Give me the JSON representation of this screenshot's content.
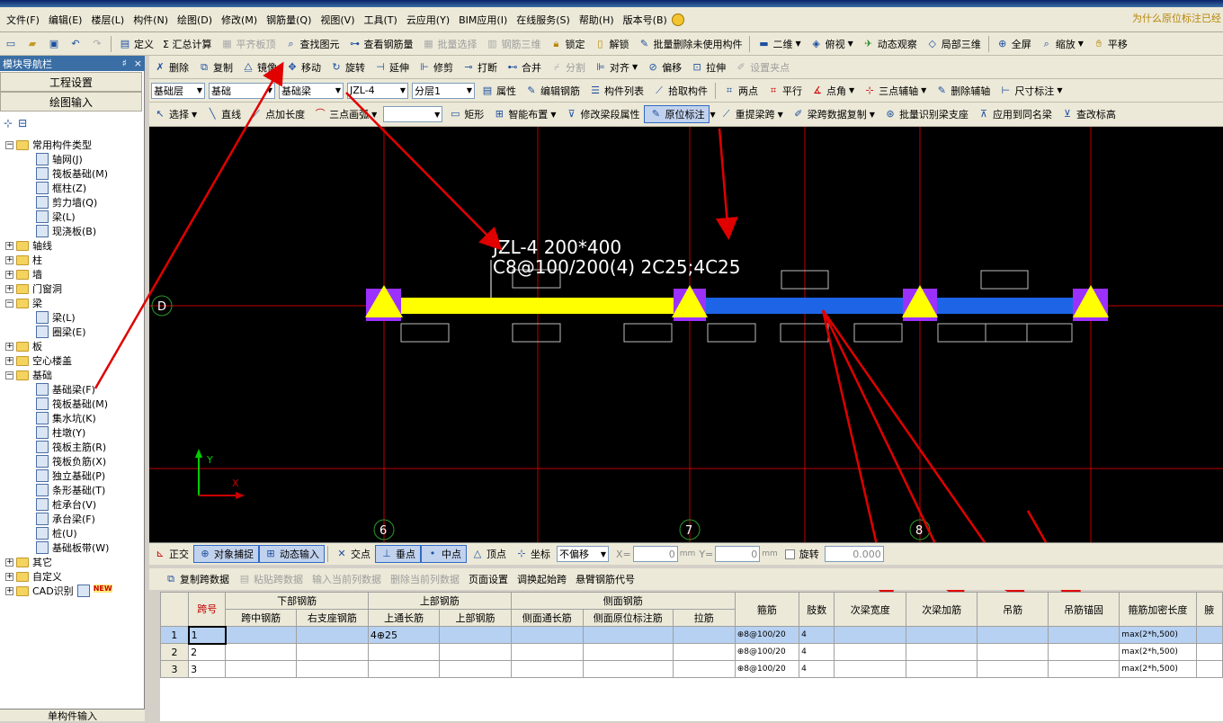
{
  "menu": [
    "文件(F)",
    "编辑(E)",
    "楼层(L)",
    "构件(N)",
    "绘图(D)",
    "修改(M)",
    "钢筋量(Q)",
    "视图(V)",
    "工具(T)",
    "云应用(Y)",
    "BIM应用(I)",
    "在线服务(S)",
    "帮助(H)",
    "版本号(B)"
  ],
  "hint_text": "为什么原位标注已经",
  "toolbar1": [
    "定义",
    "Σ 汇总计算",
    "平齐板顶",
    "查找图元",
    "查看钢筋量",
    "批量选择",
    "钢筋三维",
    "锁定",
    "解锁",
    "批量删除未使用构件",
    "二维",
    "俯视",
    "动态观察",
    "局部三维",
    "全屏",
    "缩放",
    "平移"
  ],
  "toolbar2": [
    "删除",
    "复制",
    "镜像",
    "移动",
    "旋转",
    "延伸",
    "修剪",
    "打断",
    "合并",
    "分割",
    "对齐",
    "偏移",
    "拉伸",
    "设置夹点"
  ],
  "toolbar3": {
    "floor": "基础层",
    "cat": "基础",
    "type": "基础梁",
    "comp": "JZL-4",
    "layer": "分层1",
    "btns": [
      "属性",
      "编辑钢筋",
      "构件列表",
      "拾取构件",
      "两点",
      "平行",
      "点角",
      "三点辅轴",
      "删除辅轴",
      "尺寸标注"
    ]
  },
  "toolbar4": [
    "选择",
    "直线",
    "点加长度",
    "三点画弧",
    "矩形",
    "智能布置",
    "修改梁段属性",
    "原位标注",
    "重提梁跨",
    "梁跨数据复制",
    "批量识别梁支座",
    "应用到同名梁",
    "查改标高"
  ],
  "left": {
    "title": "模块导航栏",
    "pin": "♯",
    "close": "×",
    "btn1": "工程设置",
    "btn2": "绘图输入",
    "bottom": "单构件输入",
    "tree": [
      {
        "label": "常用构件类型",
        "kind": "folder",
        "exp": "−",
        "indent": 0
      },
      {
        "label": "轴网(J)",
        "kind": "leaf",
        "indent": 1
      },
      {
        "label": "筏板基础(M)",
        "kind": "leaf",
        "indent": 1
      },
      {
        "label": "框柱(Z)",
        "kind": "leaf",
        "indent": 1
      },
      {
        "label": "剪力墙(Q)",
        "kind": "leaf",
        "indent": 1
      },
      {
        "label": "梁(L)",
        "kind": "leaf",
        "indent": 1
      },
      {
        "label": "现浇板(B)",
        "kind": "leaf",
        "indent": 1
      },
      {
        "label": "轴线",
        "kind": "folder",
        "exp": "+",
        "indent": 0
      },
      {
        "label": "柱",
        "kind": "folder",
        "exp": "+",
        "indent": 0
      },
      {
        "label": "墙",
        "kind": "folder",
        "exp": "+",
        "indent": 0
      },
      {
        "label": "门窗洞",
        "kind": "folder",
        "exp": "+",
        "indent": 0
      },
      {
        "label": "梁",
        "kind": "folder",
        "exp": "−",
        "indent": 0
      },
      {
        "label": "梁(L)",
        "kind": "leaf",
        "indent": 1
      },
      {
        "label": "圈梁(E)",
        "kind": "leaf",
        "indent": 1
      },
      {
        "label": "板",
        "kind": "folder",
        "exp": "+",
        "indent": 0
      },
      {
        "label": "空心楼盖",
        "kind": "folder",
        "exp": "+",
        "indent": 0
      },
      {
        "label": "基础",
        "kind": "folder",
        "exp": "−",
        "indent": 0
      },
      {
        "label": "基础梁(F)",
        "kind": "leaf",
        "indent": 1
      },
      {
        "label": "筏板基础(M)",
        "kind": "leaf",
        "indent": 1
      },
      {
        "label": "集水坑(K)",
        "kind": "leaf",
        "indent": 1
      },
      {
        "label": "柱墩(Y)",
        "kind": "leaf",
        "indent": 1
      },
      {
        "label": "筏板主筋(R)",
        "kind": "leaf",
        "indent": 1
      },
      {
        "label": "筏板负筋(X)",
        "kind": "leaf",
        "indent": 1
      },
      {
        "label": "独立基础(P)",
        "kind": "leaf",
        "indent": 1
      },
      {
        "label": "条形基础(T)",
        "kind": "leaf",
        "indent": 1
      },
      {
        "label": "桩承台(V)",
        "kind": "leaf",
        "indent": 1
      },
      {
        "label": "承台梁(F)",
        "kind": "leaf",
        "indent": 1
      },
      {
        "label": "桩(U)",
        "kind": "leaf",
        "indent": 1
      },
      {
        "label": "基础板带(W)",
        "kind": "leaf",
        "indent": 1
      },
      {
        "label": "其它",
        "kind": "folder",
        "exp": "+",
        "indent": 0
      },
      {
        "label": "自定义",
        "kind": "folder",
        "exp": "+",
        "indent": 0
      },
      {
        "label": "CAD识别",
        "kind": "folder",
        "exp": "+",
        "indent": 0,
        "badge": "NEW"
      }
    ]
  },
  "canvas": {
    "beam_label1": "JZL-4 200*400",
    "beam_label2": "C8@100/200(4) 2C25;4C25",
    "axis_row": "D",
    "axis_cols": [
      "6",
      "7",
      "8"
    ],
    "coord_y": "Y",
    "coord_x": "X"
  },
  "snapbar": {
    "btns": [
      "正交",
      "对象捕捉",
      "动态输入",
      "交点",
      "垂点",
      "中点",
      "顶点",
      "坐标"
    ],
    "offset": "不偏移",
    "x_label": "X=",
    "x_val": "0",
    "x_unit": "mm",
    "y_label": "Y=",
    "y_val": "0",
    "y_unit": "mm",
    "rotate": "旋转",
    "rot_val": "0.000"
  },
  "gridbar": [
    "复制跨数据",
    "粘贴跨数据",
    "输入当前列数据",
    "删除当前列数据",
    "页面设置",
    "调换起始跨",
    "悬臂钢筋代号"
  ],
  "grid": {
    "headers_top": [
      "跨号",
      "下部钢筋",
      "上部钢筋",
      "侧面钢筋",
      "箍筋",
      "肢数",
      "次梁宽度",
      "次梁加筋",
      "吊筋",
      "吊筋锚固",
      "箍筋加密长度",
      "腋"
    ],
    "headers_sub": [
      "跨中钢筋",
      "右支座钢筋",
      "上通长筋",
      "上部钢筋",
      "侧面通长筋",
      "侧面原位标注筋",
      "拉筋"
    ],
    "rows": [
      {
        "n": "1",
        "span": "1",
        "top": "4⊕25",
        "stir": "⊕8@100/20",
        "legs": "4",
        "dense": "max(2*h,500)"
      },
      {
        "n": "2",
        "span": "2",
        "top": "",
        "stir": "⊕8@100/20",
        "legs": "4",
        "dense": "max(2*h,500)"
      },
      {
        "n": "3",
        "span": "3",
        "top": "",
        "stir": "⊕8@100/20",
        "legs": "4",
        "dense": "max(2*h,500)"
      }
    ]
  },
  "colors": {
    "beam_yellow": "#ffff00",
    "beam_blue": "#1e64e6",
    "support": "#9b30ff",
    "axis_red": "#c00000",
    "arrow": "#e00000",
    "canvas_bg": "#000000",
    "label": "#ffffff"
  }
}
